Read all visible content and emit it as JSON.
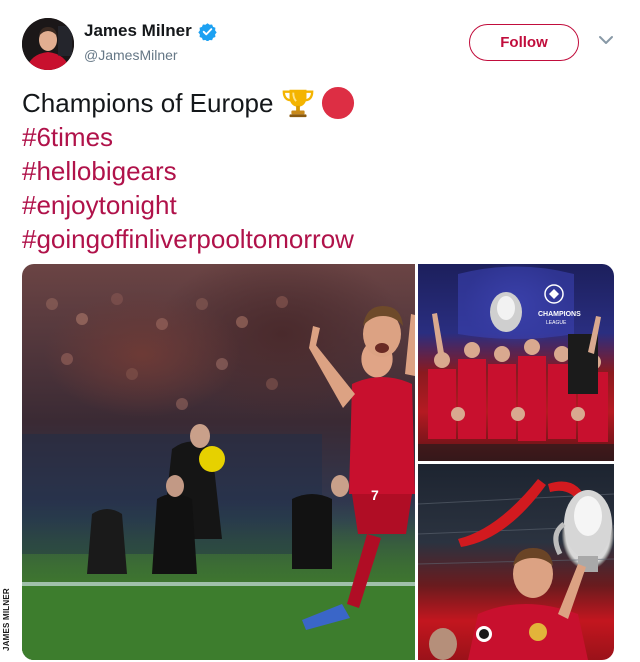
{
  "user": {
    "display_name": "James Milner",
    "handle": "@JamesMilner",
    "verified": true,
    "avatar_icon": "profile-photo"
  },
  "actions": {
    "follow_label": "Follow",
    "more_icon": "chevron-down-icon"
  },
  "tweet": {
    "first_line": "Champions of Europe",
    "emojis": [
      "trophy-icon",
      "red-circle-icon"
    ],
    "hashtags": [
      "#6times",
      "#hellobigears",
      "#enjoytonight",
      "#goingoffinliverpooltomorrow"
    ]
  },
  "media": {
    "count": 3,
    "photos": [
      "player-celebrating-photo",
      "team-trophy-lift-photo",
      "player-with-trophy-photo"
    ]
  },
  "watermark": "JAMES MILNER",
  "colors": {
    "accent": "#c10d3c",
    "hashtag": "#b0124a",
    "verified": "#1da1f2",
    "text": "#14171a",
    "secondary": "#657786"
  }
}
